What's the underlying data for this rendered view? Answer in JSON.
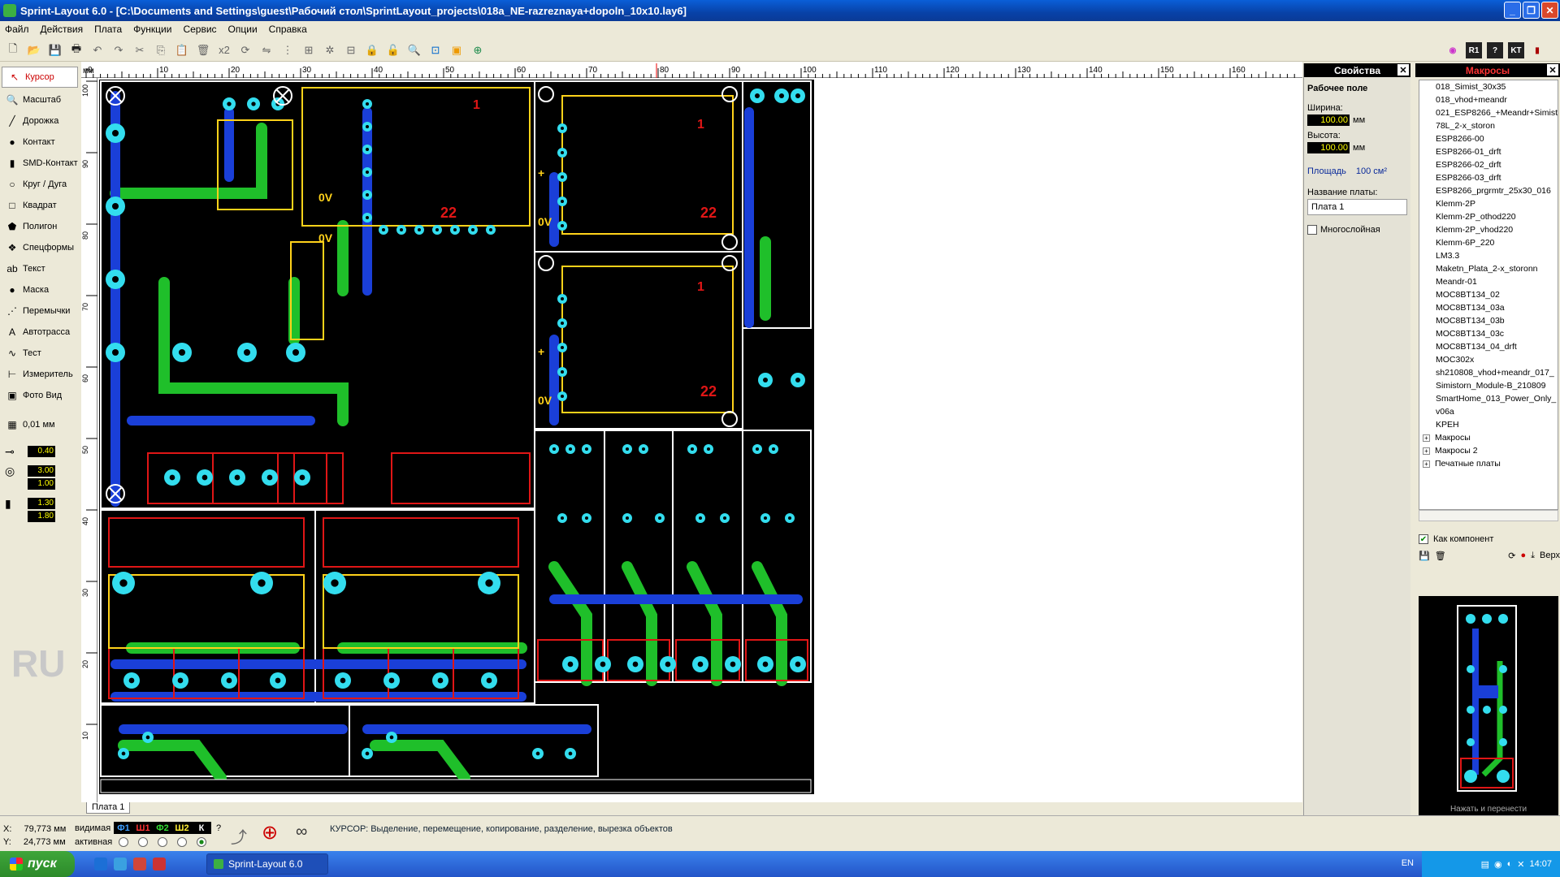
{
  "window": {
    "title": "Sprint-Layout 6.0 - [C:\\Documents and Settings\\guest\\Рабочий стол\\SprintLayout_projects\\018a_NE-razreznaya+dopoln_10x10.lay6]",
    "min": "_",
    "restore": "❐",
    "close": "✕"
  },
  "menu": [
    "Файл",
    "Действия",
    "Плата",
    "Функции",
    "Сервис",
    "Опции",
    "Справка"
  ],
  "toolbar": {
    "zoom_x2": "x2"
  },
  "tools": [
    {
      "label": "Курсор",
      "icon": "cursor-icon",
      "glyph": "↖"
    },
    {
      "label": "Масштаб",
      "icon": "zoom-icon",
      "glyph": "🔍"
    },
    {
      "label": "Дорожка",
      "icon": "track-icon",
      "glyph": "╱"
    },
    {
      "label": "Контакт",
      "icon": "pad-icon",
      "glyph": "●"
    },
    {
      "label": "SMD-Контакт",
      "icon": "smd-pad-icon",
      "glyph": "▮"
    },
    {
      "label": "Круг / Дуга",
      "icon": "circle-icon",
      "glyph": "○"
    },
    {
      "label": "Квадрат",
      "icon": "square-icon",
      "glyph": "□"
    },
    {
      "label": "Полигон",
      "icon": "polygon-icon",
      "glyph": "⬟"
    },
    {
      "label": "Спецформы",
      "icon": "special-forms-icon",
      "glyph": "❖"
    },
    {
      "label": "Текст",
      "icon": "text-icon",
      "glyph": "ab"
    },
    {
      "label": "Маска",
      "icon": "mask-icon",
      "glyph": "●"
    },
    {
      "label": "Перемычки",
      "icon": "jumper-icon",
      "glyph": "⋰"
    },
    {
      "label": "Автотрасса",
      "icon": "autoroute-icon",
      "glyph": "A"
    },
    {
      "label": "Тест",
      "icon": "test-icon",
      "glyph": "∿"
    },
    {
      "label": "Измеритель",
      "icon": "measure-icon",
      "glyph": "⊢"
    },
    {
      "label": "Фото Вид",
      "icon": "photo-view-icon",
      "glyph": "▣"
    }
  ],
  "grid": {
    "label": "0,01 мм"
  },
  "params": {
    "track_width": "0.40",
    "pad_outer": "3.00",
    "pad_inner": "1.00",
    "smd_w": "1.30",
    "smd_h": "1.80"
  },
  "lang_watermark": "RU",
  "ruler": {
    "unit": "мм",
    "h_ticks": [
      "0",
      "10",
      "20",
      "30",
      "40",
      "50",
      "60",
      "70",
      "80",
      "90",
      "100",
      "110",
      "120",
      "130",
      "140",
      "150",
      "160"
    ],
    "v_ticks": [
      "100",
      "90",
      "80",
      "70",
      "60",
      "50",
      "40",
      "30",
      "20",
      "10"
    ]
  },
  "board_tab": "Плата 1",
  "properties": {
    "header": "Свойства",
    "section": "Рабочее поле",
    "width_label": "Ширина:",
    "width_value": "100.00",
    "width_unit": "мм",
    "height_label": "Высота:",
    "height_value": "100.00",
    "height_unit": "мм",
    "area_label": "Площадь",
    "area_value": "100 см²",
    "name_label": "Название платы:",
    "name_value": "Плата 1",
    "multilayer_label": "Многослойная"
  },
  "macros": {
    "header": "Макросы",
    "items": [
      "018_Simist_30x35",
      "018_vhod+meandr",
      "021_ESP8266_+Meandr+Simist",
      "78L_2-x_storon",
      "ESP8266-00",
      "ESP8266-01_drft",
      "ESP8266-02_drft",
      "ESP8266-03_drft",
      "ESP8266_prgrmtr_25x30_016",
      "Klemm-2P",
      "Klemm-2P_othod220",
      "Klemm-2P_vhod220",
      "Klemm-6P_220",
      "LM3.3",
      "Maketn_Plata_2-x_storonn",
      "Meandr-01",
      "MOC8BT134_02",
      "MOC8BT134_03a",
      "MOC8BT134_03b",
      "MOC8BT134_03c",
      "MOC8BT134_04_drft",
      "MOC302x",
      "sh210808_vhod+meandr_017_",
      "Simistorn_Module-B_210809",
      "SmartHome_013_Power_Only_",
      "v06a",
      "KPEH"
    ],
    "groups": [
      "Макросы",
      "Макросы 2",
      "Печатные платы"
    ],
    "as_component": "Как компонент",
    "top_label": "Верх",
    "preview_hint": "Нажать и перенести"
  },
  "status": {
    "x_label": "X:",
    "x_value": "79,773 мм",
    "y_label": "Y:",
    "y_value": "24,773 мм",
    "visible_label": "видимая",
    "active_label": "активная",
    "layers": [
      {
        "name": "Ф1",
        "color": "#3fa0ff"
      },
      {
        "name": "Ш1",
        "color": "#ff3333"
      },
      {
        "name": "Ф2",
        "color": "#33dd33"
      },
      {
        "name": "Ш2",
        "color": "#ffee33"
      },
      {
        "name": "К",
        "color": "#ffffff"
      }
    ],
    "help": "?",
    "message": "КУРСОР: Выделение, перемещение, копирование, разделение, вырезка объектов"
  },
  "taskbar": {
    "start": "пуск",
    "task": "Sprint-Layout 6.0",
    "lang": "EN",
    "clock": "14:07"
  },
  "colors": {
    "copper_top": "#1a3fd8",
    "copper_bottom": "#1fbf2a",
    "pad": "#33ddee",
    "silk": "#ffd21a",
    "red_outline": "#e01616"
  }
}
